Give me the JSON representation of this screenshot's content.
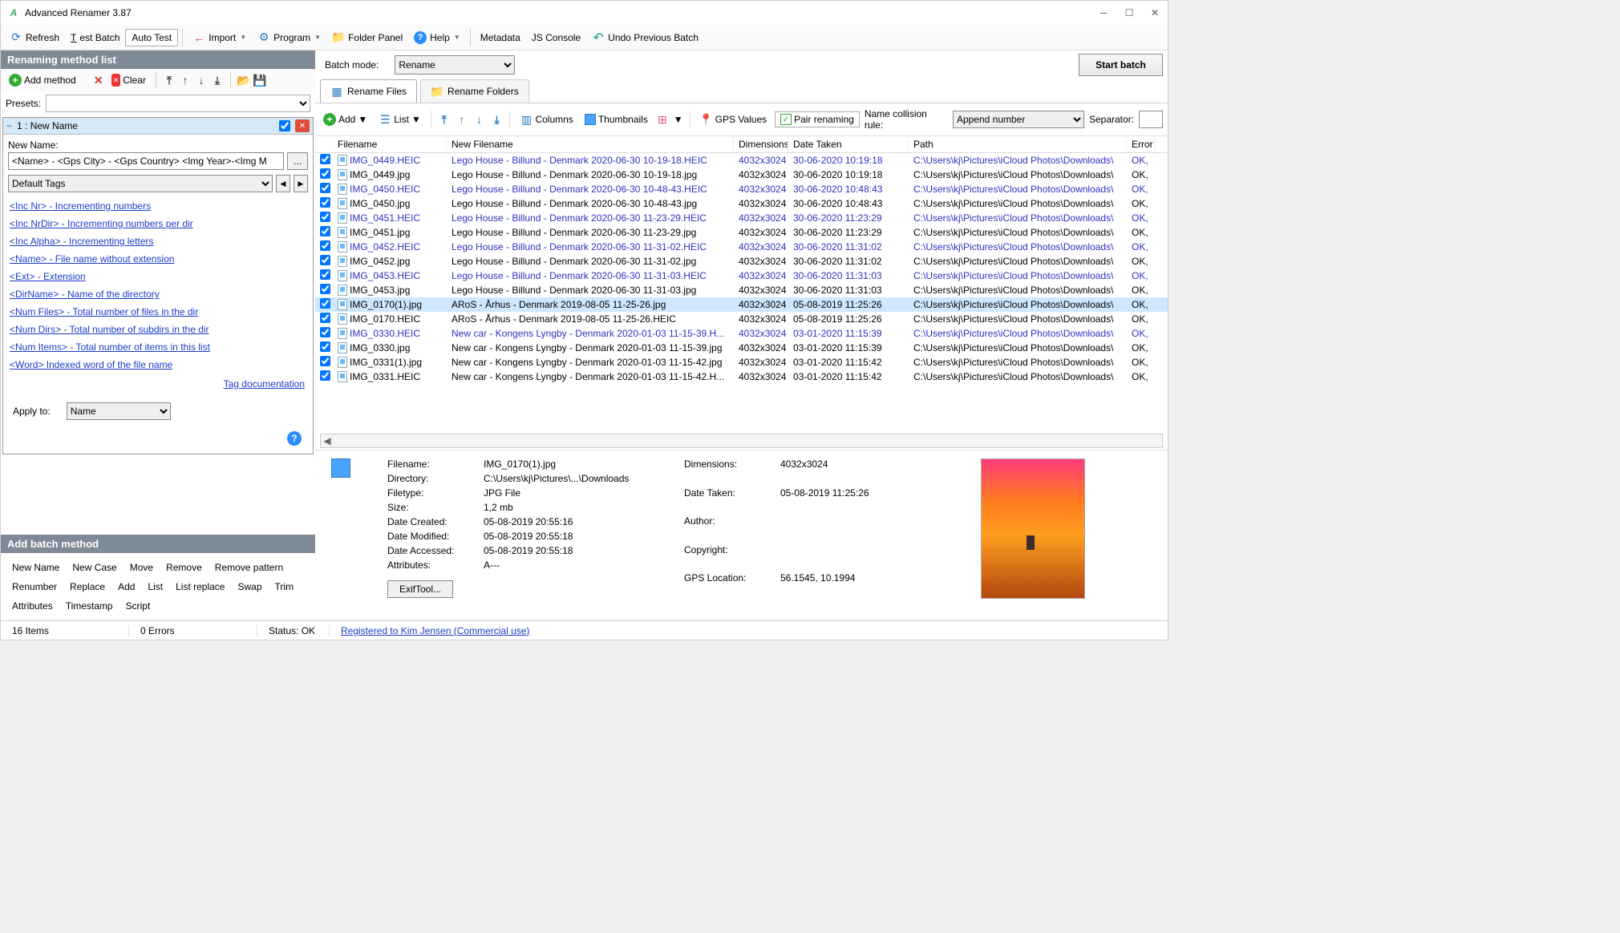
{
  "title": "Advanced Renamer 3.87",
  "toolbar": {
    "refresh": "Refresh",
    "test_batch": "Test Batch",
    "auto_test": "Auto Test",
    "import": "Import",
    "program": "Program",
    "folder_panel": "Folder Panel",
    "help": "Help",
    "metadata": "Metadata",
    "js_console": "JS Console",
    "undo": "Undo Previous Batch"
  },
  "left": {
    "methods_title": "Renaming method list",
    "add_method": "Add method",
    "clear": "Clear",
    "presets_label": "Presets:",
    "method1_title": "1 : New Name",
    "new_name_label": "New Name:",
    "new_name_value": "<Name> - <Gps City> - <Gps Country> <Img Year>-<Img M",
    "default_tags": "Default Tags",
    "tags": [
      "<Inc Nr> - Incrementing numbers",
      "<Inc NrDir> - Incrementing numbers per dir",
      "<Inc Alpha> - Incrementing letters",
      "<Name> - File name without extension",
      "<Ext> - Extension",
      "<DirName> - Name of the directory",
      "<Num Files> - Total number of files in the dir",
      "<Num Dirs> - Total number of subdirs in the dir",
      "<Num Items> - Total number of items in this list",
      "<Word> Indexed word of the file name"
    ],
    "tag_doc": "Tag documentation",
    "apply_to_label": "Apply to:",
    "apply_to_value": "Name",
    "add_batch_title": "Add batch method",
    "batch_methods": [
      "New Name",
      "New Case",
      "Move",
      "Remove",
      "Remove pattern",
      "Renumber",
      "Replace",
      "Add",
      "List",
      "List replace",
      "Swap",
      "Trim",
      "Attributes",
      "Timestamp",
      "Script"
    ]
  },
  "right": {
    "batch_mode_label": "Batch mode:",
    "batch_mode_value": "Rename",
    "start_batch": "Start batch",
    "tab_files": "Rename Files",
    "tab_folders": "Rename Folders",
    "ftb": {
      "add": "Add",
      "list": "List",
      "columns": "Columns",
      "thumbnails": "Thumbnails",
      "gps": "GPS Values",
      "pair": "Pair renaming",
      "collision_label": "Name collision rule:",
      "collision_value": "Append number",
      "sep_label": "Separator:"
    },
    "cols": {
      "fn": "Filename",
      "nfn": "New Filename",
      "dim": "Dimensions",
      "dt": "Date Taken",
      "pth": "Path",
      "err": "Error"
    },
    "rows": [
      {
        "fn": "IMG_0449.HEIC",
        "nfn": "Lego House - Billund - Denmark 2020-06-30 10-19-18.HEIC",
        "dim": "4032x3024",
        "dt": "30-06-2020 10:19:18",
        "pth": "C:\\Users\\kj\\Pictures\\iCloud Photos\\Downloads\\",
        "err": "OK,",
        "link": true,
        "sel": false
      },
      {
        "fn": "IMG_0449.jpg",
        "nfn": "Lego House - Billund - Denmark 2020-06-30 10-19-18.jpg",
        "dim": "4032x3024",
        "dt": "30-06-2020 10:19:18",
        "pth": "C:\\Users\\kj\\Pictures\\iCloud Photos\\Downloads\\",
        "err": "OK,",
        "link": false,
        "sel": false
      },
      {
        "fn": "IMG_0450.HEIC",
        "nfn": "Lego House - Billund - Denmark 2020-06-30 10-48-43.HEIC",
        "dim": "4032x3024",
        "dt": "30-06-2020 10:48:43",
        "pth": "C:\\Users\\kj\\Pictures\\iCloud Photos\\Downloads\\",
        "err": "OK,",
        "link": true,
        "sel": false
      },
      {
        "fn": "IMG_0450.jpg",
        "nfn": "Lego House - Billund - Denmark 2020-06-30 10-48-43.jpg",
        "dim": "4032x3024",
        "dt": "30-06-2020 10:48:43",
        "pth": "C:\\Users\\kj\\Pictures\\iCloud Photos\\Downloads\\",
        "err": "OK,",
        "link": false,
        "sel": false
      },
      {
        "fn": "IMG_0451.HEIC",
        "nfn": "Lego House - Billund - Denmark 2020-06-30 11-23-29.HEIC",
        "dim": "4032x3024",
        "dt": "30-06-2020 11:23:29",
        "pth": "C:\\Users\\kj\\Pictures\\iCloud Photos\\Downloads\\",
        "err": "OK,",
        "link": true,
        "sel": false
      },
      {
        "fn": "IMG_0451.jpg",
        "nfn": "Lego House - Billund - Denmark 2020-06-30 11-23-29.jpg",
        "dim": "4032x3024",
        "dt": "30-06-2020 11:23:29",
        "pth": "C:\\Users\\kj\\Pictures\\iCloud Photos\\Downloads\\",
        "err": "OK,",
        "link": false,
        "sel": false
      },
      {
        "fn": "IMG_0452.HEIC",
        "nfn": "Lego House - Billund - Denmark 2020-06-30 11-31-02.HEIC",
        "dim": "4032x3024",
        "dt": "30-06-2020 11:31:02",
        "pth": "C:\\Users\\kj\\Pictures\\iCloud Photos\\Downloads\\",
        "err": "OK,",
        "link": true,
        "sel": false
      },
      {
        "fn": "IMG_0452.jpg",
        "nfn": "Lego House - Billund - Denmark 2020-06-30 11-31-02.jpg",
        "dim": "4032x3024",
        "dt": "30-06-2020 11:31:02",
        "pth": "C:\\Users\\kj\\Pictures\\iCloud Photos\\Downloads\\",
        "err": "OK,",
        "link": false,
        "sel": false
      },
      {
        "fn": "IMG_0453.HEIC",
        "nfn": "Lego House - Billund - Denmark 2020-06-30 11-31-03.HEIC",
        "dim": "4032x3024",
        "dt": "30-06-2020 11:31:03",
        "pth": "C:\\Users\\kj\\Pictures\\iCloud Photos\\Downloads\\",
        "err": "OK,",
        "link": true,
        "sel": false
      },
      {
        "fn": "IMG_0453.jpg",
        "nfn": "Lego House - Billund - Denmark 2020-06-30 11-31-03.jpg",
        "dim": "4032x3024",
        "dt": "30-06-2020 11:31:03",
        "pth": "C:\\Users\\kj\\Pictures\\iCloud Photos\\Downloads\\",
        "err": "OK,",
        "link": false,
        "sel": false
      },
      {
        "fn": "IMG_0170(1).jpg",
        "nfn": "ARoS - Århus - Denmark 2019-08-05 11-25-26.jpg",
        "dim": "4032x3024",
        "dt": "05-08-2019 11:25:26",
        "pth": "C:\\Users\\kj\\Pictures\\iCloud Photos\\Downloads\\",
        "err": "OK,",
        "link": false,
        "sel": true
      },
      {
        "fn": "IMG_0170.HEIC",
        "nfn": "ARoS - Århus - Denmark 2019-08-05 11-25-26.HEIC",
        "dim": "4032x3024",
        "dt": "05-08-2019 11:25:26",
        "pth": "C:\\Users\\kj\\Pictures\\iCloud Photos\\Downloads\\",
        "err": "OK,",
        "link": false,
        "sel": false
      },
      {
        "fn": "IMG_0330.HEIC",
        "nfn": "New car - Kongens Lyngby - Denmark 2020-01-03 11-15-39.H...",
        "dim": "4032x3024",
        "dt": "03-01-2020 11:15:39",
        "pth": "C:\\Users\\kj\\Pictures\\iCloud Photos\\Downloads\\",
        "err": "OK,",
        "link": true,
        "sel": false
      },
      {
        "fn": "IMG_0330.jpg",
        "nfn": "New car - Kongens Lyngby - Denmark 2020-01-03 11-15-39.jpg",
        "dim": "4032x3024",
        "dt": "03-01-2020 11:15:39",
        "pth": "C:\\Users\\kj\\Pictures\\iCloud Photos\\Downloads\\",
        "err": "OK,",
        "link": false,
        "sel": false
      },
      {
        "fn": "IMG_0331(1).jpg",
        "nfn": "New car - Kongens Lyngby - Denmark 2020-01-03 11-15-42.jpg",
        "dim": "4032x3024",
        "dt": "03-01-2020 11:15:42",
        "pth": "C:\\Users\\kj\\Pictures\\iCloud Photos\\Downloads\\",
        "err": "OK,",
        "link": false,
        "sel": false
      },
      {
        "fn": "IMG_0331.HEIC",
        "nfn": "New car - Kongens Lyngby - Denmark 2020-01-03 11-15-42.H...",
        "dim": "4032x3024",
        "dt": "03-01-2020 11:15:42",
        "pth": "C:\\Users\\kj\\Pictures\\iCloud Photos\\Downloads\\",
        "err": "OK,",
        "link": false,
        "sel": false
      }
    ],
    "info": {
      "labels": {
        "filename": "Filename:",
        "directory": "Directory:",
        "filetype": "Filetype:",
        "size": "Size:",
        "created": "Date Created:",
        "modified": "Date Modified:",
        "accessed": "Date Accessed:",
        "attributes": "Attributes:",
        "dimensions": "Dimensions:",
        "datetaken": "Date Taken:",
        "author": "Author:",
        "copyright": "Copyright:",
        "gps": "GPS Location:"
      },
      "values": {
        "filename": "IMG_0170(1).jpg",
        "directory": "C:\\Users\\kj\\Pictures\\...\\Downloads",
        "filetype": "JPG File",
        "size": "1,2 mb",
        "created": "05-08-2019 20:55:16",
        "modified": "05-08-2019 20:55:18",
        "accessed": "05-08-2019 20:55:18",
        "attributes": "A---",
        "dimensions": "4032x3024",
        "datetaken": "05-08-2019 11:25:26",
        "author": "",
        "copyright": "",
        "gps": "56.1545, 10.1994"
      },
      "exif_btn": "ExifTool..."
    }
  },
  "status": {
    "items": "16 Items",
    "errors": "0 Errors",
    "status_label": "Status:",
    "status_value": "OK",
    "reg": "Registered to Kim Jensen (Commercial use)"
  }
}
